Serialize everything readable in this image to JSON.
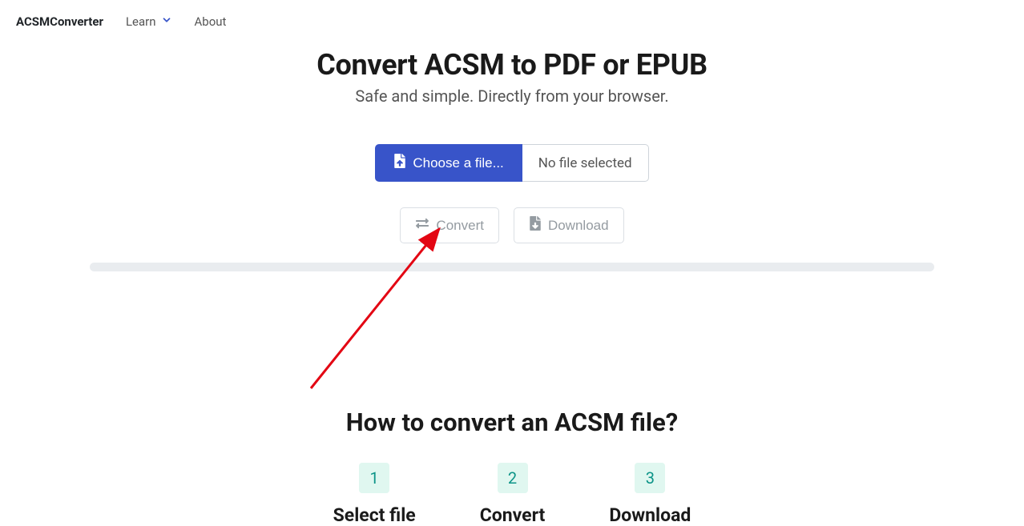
{
  "navbar": {
    "brand": "ACSMConverter",
    "learn_label": "Learn",
    "about_label": "About"
  },
  "hero": {
    "title": "Convert ACSM to PDF or EPUB",
    "subtitle": "Safe and simple. Directly from your browser."
  },
  "file_select": {
    "choose_label": "Choose a file...",
    "status_label": "No file selected"
  },
  "actions": {
    "convert_label": "Convert",
    "download_label": "Download"
  },
  "howto": {
    "title": "How to convert an ACSM file?",
    "steps": [
      {
        "num": "1",
        "label": "Select file"
      },
      {
        "num": "2",
        "label": "Convert"
      },
      {
        "num": "3",
        "label": "Download"
      }
    ]
  },
  "colors": {
    "primary": "#3854c9",
    "step_bg": "#e0f7f0",
    "step_fg": "#0d9488",
    "annotation": "#e30613"
  }
}
